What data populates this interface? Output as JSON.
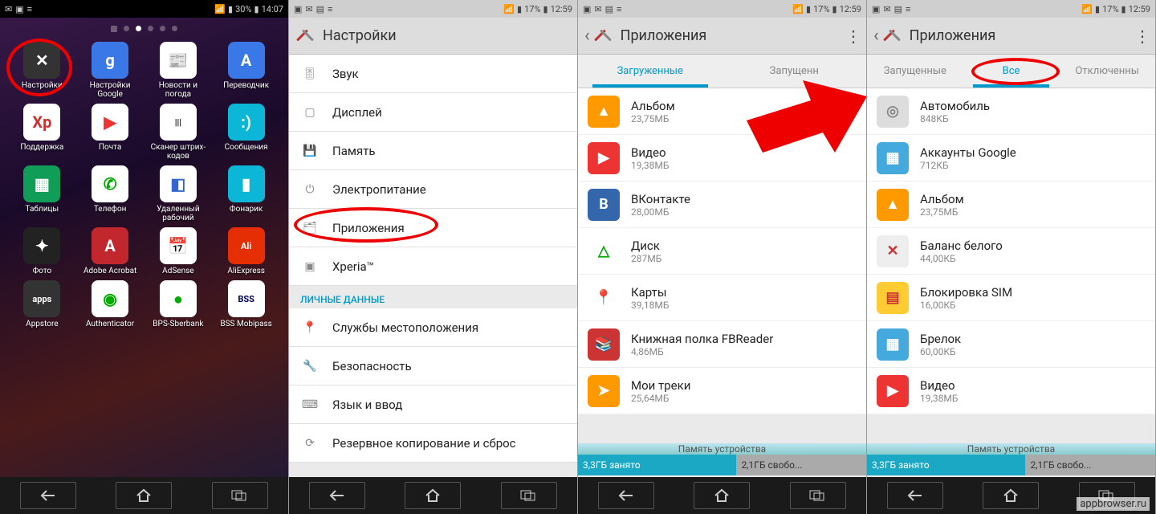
{
  "watermark": "appbrowser.ru",
  "s1": {
    "battery": "30%",
    "time": "14:07",
    "apps": [
      {
        "l": "Настройки",
        "c": "#333",
        "t": "✕"
      },
      {
        "l": "Настройки Google",
        "c": "#3b78e7",
        "t": "g"
      },
      {
        "l": "Новости и погода",
        "c": "#fff",
        "t": "📰",
        "fg": "#36c"
      },
      {
        "l": "Переводчик",
        "c": "#3b78e7",
        "t": "A"
      },
      {
        "l": "Поддержка",
        "c": "#fff",
        "t": "Xp",
        "fg": "#c33"
      },
      {
        "l": "Почта",
        "c": "#fff",
        "t": "▶",
        "fg": "#e33"
      },
      {
        "l": "Сканер штрих-кодов",
        "c": "#fff",
        "t": "|||",
        "fg": "#000"
      },
      {
        "l": "Сообщения",
        "c": "#0bb6d6",
        "t": ":)"
      },
      {
        "l": "Таблицы",
        "c": "#0f9d58",
        "t": "▦"
      },
      {
        "l": "Телефон",
        "c": "#fff",
        "t": "✆",
        "fg": "#0a0"
      },
      {
        "l": "Удаленный рабочий",
        "c": "#fff",
        "t": "◧",
        "fg": "#36c"
      },
      {
        "l": "Фонарик",
        "c": "#0bb6d6",
        "t": "▮"
      },
      {
        "l": "Фото",
        "c": "#222",
        "t": "✦"
      },
      {
        "l": "Adobe Acrobat",
        "c": "#c1272d",
        "t": "A"
      },
      {
        "l": "AdSense",
        "c": "#fff",
        "t": "📅",
        "fg": "#36c"
      },
      {
        "l": "AliExpress",
        "c": "#e62e04",
        "t": "Ali"
      },
      {
        "l": "Appstore",
        "c": "#333",
        "t": "apps"
      },
      {
        "l": "Authenticator",
        "c": "#fff",
        "t": "◉",
        "fg": "#0a0"
      },
      {
        "l": "BPS-Sberbank",
        "c": "#fff",
        "t": "●",
        "fg": "#0a0"
      },
      {
        "l": "BSS Mobipass",
        "c": "#fff",
        "t": "BSS",
        "fg": "#005"
      }
    ]
  },
  "s2": {
    "battery": "17%",
    "time": "12:59",
    "title": "Настройки",
    "section": "ЛИЧНЫЕ ДАННЫЕ",
    "items": [
      {
        "l": "Звук",
        "i": "🎚"
      },
      {
        "l": "Дисплей",
        "i": "▢"
      },
      {
        "l": "Память",
        "i": "💾"
      },
      {
        "l": "Электропитание",
        "i": "⏻"
      },
      {
        "l": "Приложения",
        "i": "🗂"
      },
      {
        "l": "Xperia™",
        "i": "▣"
      }
    ],
    "items2": [
      {
        "l": "Службы местоположения",
        "i": "📍"
      },
      {
        "l": "Безопасность",
        "i": "🔧"
      },
      {
        "l": "Язык и ввод",
        "i": "⌨"
      },
      {
        "l": "Резервное копирование и сброс",
        "i": "⟳"
      }
    ]
  },
  "s3": {
    "battery": "17%",
    "time": "12:59",
    "title": "Приложения",
    "tabs": [
      "Загруженные",
      "Запущенн"
    ],
    "active": 0,
    "apps": [
      {
        "n": "Альбом",
        "s": "23,75МБ",
        "c": "#f90",
        "t": "▲"
      },
      {
        "n": "Видео",
        "s": "19,38МБ",
        "c": "#e33",
        "t": "▶"
      },
      {
        "n": "ВКонтакте",
        "s": "28,00МБ",
        "c": "#36a",
        "t": "B"
      },
      {
        "n": "Диск",
        "s": "287МБ",
        "c": "#fff",
        "t": "△",
        "fg": "#0a0"
      },
      {
        "n": "Карты",
        "s": "39,18МБ",
        "c": "#fff",
        "t": "📍",
        "fg": "#e33"
      },
      {
        "n": "Книжная полка FBReader",
        "s": "4,86МБ",
        "c": "#c33",
        "t": "📚"
      },
      {
        "n": "Мои треки",
        "s": "25,64МБ",
        "c": "#f90",
        "t": "➤"
      }
    ],
    "stor_label": "Память устройства",
    "used": "3,3ГБ занято",
    "free": "2,1ГБ свобо..."
  },
  "s4": {
    "battery": "17%",
    "time": "12:59",
    "title": "Приложения",
    "tabs": [
      "Запущенные",
      "Все",
      "Отключенны"
    ],
    "active": 1,
    "apps": [
      {
        "n": "Автомобиль",
        "s": "848КБ",
        "c": "#ddd",
        "t": "◎",
        "fg": "#888"
      },
      {
        "n": "Аккаунты Google",
        "s": "712КБ",
        "c": "#4ad",
        "t": "▦"
      },
      {
        "n": "Альбом",
        "s": "23,75МБ",
        "c": "#f90",
        "t": "▲"
      },
      {
        "n": "Баланс белого",
        "s": "44,00КБ",
        "c": "#eee",
        "t": "✕",
        "fg": "#c33"
      },
      {
        "n": "Блокировка SIM",
        "s": "16,00КБ",
        "c": "#fc3",
        "t": "▤",
        "fg": "#c33"
      },
      {
        "n": "Брелок",
        "s": "60,00КБ",
        "c": "#4ad",
        "t": "▦"
      },
      {
        "n": "Видео",
        "s": "19,38МБ",
        "c": "#e33",
        "t": "▶"
      }
    ],
    "stor_label": "Память устройства",
    "used": "3,3ГБ занято",
    "free": "2,1ГБ свобо..."
  }
}
